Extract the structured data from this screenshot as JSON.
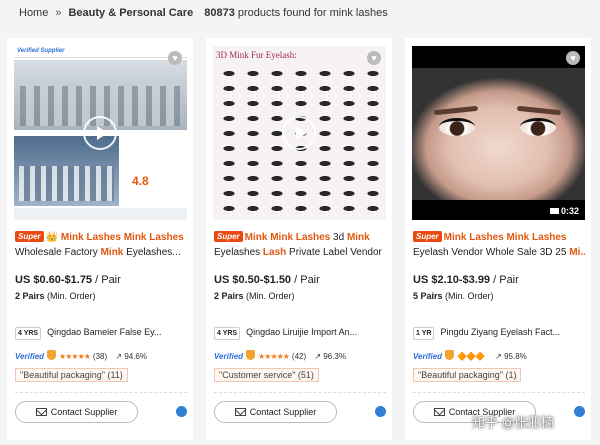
{
  "breadcrumb": {
    "home": "Home",
    "separator": "»",
    "category": "Beauty & Personal Care",
    "count": "80873",
    "results_text": "products found for mink lashes"
  },
  "products": [
    {
      "badge": "Super",
      "title_parts": [
        "👑 ",
        "Mink Lashes Mink Lashes",
        "Wholesale Factory ",
        "Mink",
        " Eyelashes..."
      ],
      "price": "US $0.60-$1.75",
      "price_unit": " / Pair",
      "moq_qty": "2 Pairs",
      "moq_label": " (Min. Order)",
      "years": "4 YRS",
      "supplier": "Qingdao Bameier False Ey...",
      "verified": "Verified",
      "stars": "★★★★★",
      "reviews": "(38)",
      "response": "94.6%",
      "tag": "\"Beautiful packaging\" (11)",
      "contact": "Contact Supplier",
      "has_play": true
    },
    {
      "badge": "Super",
      "title_parts": [
        "",
        "Mink Mink Lashes",
        " 3d ",
        "Mink",
        ""
      ],
      "title_line2": [
        "Eyelashes ",
        "Lash",
        " Private Label Vendor"
      ],
      "price": "US $0.50-$1.50",
      "price_unit": " / Pair",
      "moq_qty": "2 Pairs",
      "moq_label": " (Min. Order)",
      "years": "4 YRS",
      "supplier": "Qingdao Liruijie Import An...",
      "verified": "Verified",
      "stars": "★★★★★",
      "reviews": "(42)",
      "response": "96.3%",
      "tag": "\"Customer service\" (51)",
      "contact": "Contact Supplier",
      "has_play": true
    },
    {
      "badge": "Super",
      "title_parts": [
        "",
        "Mink Lashes Mink Lashes",
        "Eyelash Vendor Whole Sale 3D 25 ",
        "Mi...",
        ""
      ],
      "price": "US $2.10-$3.99",
      "price_unit": " / Pair",
      "moq_qty": "5 Pairs",
      "moq_label": " (Min. Order)",
      "years": "1 YR",
      "supplier": "Pingdu Ziyang Eyelash Fact...",
      "verified": "Verified",
      "stars": "🔶🔶🔶",
      "reviews": "",
      "response": "95.8%",
      "tag": "\"Beautiful packaging\" (1)",
      "contact": "Contact Supplier",
      "video_length": "0:32"
    }
  ],
  "thumb2_heading": "3D Mink Fur Eyelash:",
  "thumb1_banner": "Verified  Supplier",
  "thumb1_rating": "4.8",
  "watermark": "知乎 @张亚楠",
  "colors": {
    "accent": "#e0580f",
    "verified": "#2f6fd6"
  }
}
